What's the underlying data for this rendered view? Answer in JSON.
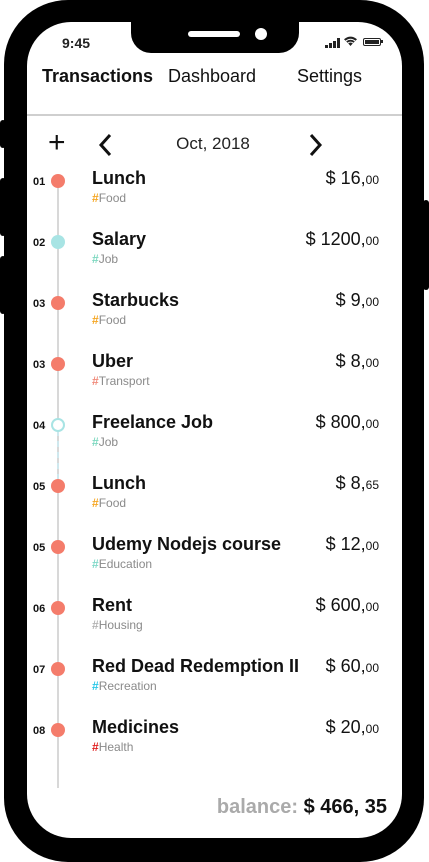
{
  "status_bar": {
    "time": "9:45"
  },
  "tabs": [
    {
      "label": "Transactions"
    },
    {
      "label": "Dashboard"
    },
    {
      "label": "Settings"
    }
  ],
  "period": {
    "label": "Oct, 2018"
  },
  "colors": {
    "food": "#f5a623",
    "job": "#7ed8c0",
    "transport": "#f08a7a",
    "education": "#7fd8c8",
    "housing": "#b3b3b3",
    "recreation": "#29c7e8",
    "health": "#e02020",
    "dot_expense": "#f47c6b",
    "dot_income": "#a8e4e4"
  },
  "transactions": [
    {
      "day": "01",
      "title": "Lunch",
      "tag": "Food",
      "amount_main": "$ 16,",
      "amount_cents": "00"
    },
    {
      "day": "02",
      "title": "Salary",
      "tag": "Job",
      "amount_main": "$ 1200,",
      "amount_cents": "00"
    },
    {
      "day": "03",
      "title": "Starbucks",
      "tag": "Food",
      "amount_main": "$ 9,",
      "amount_cents": "00"
    },
    {
      "day": "03",
      "title": "Uber",
      "tag": "Transport",
      "amount_main": "$ 8,",
      "amount_cents": "00"
    },
    {
      "day": "04",
      "title": "Freelance Job",
      "tag": "Job",
      "amount_main": "$ 800,",
      "amount_cents": "00"
    },
    {
      "day": "05",
      "title": "Lunch",
      "tag": "Food",
      "amount_main": "$ 8,",
      "amount_cents": "65"
    },
    {
      "day": "05",
      "title": "Udemy Nodejs course",
      "tag": "Education",
      "amount_main": "$ 12,",
      "amount_cents": "00"
    },
    {
      "day": "06",
      "title": "Rent",
      "tag": "Housing",
      "amount_main": "$ 600,",
      "amount_cents": "00"
    },
    {
      "day": "07",
      "title": "Red Dead Redemption II",
      "tag": "Recreation",
      "amount_main": "$ 60,",
      "amount_cents": "00"
    },
    {
      "day": "08",
      "title": "Medicines",
      "tag": "Health",
      "amount_main": "$ 20,",
      "amount_cents": "00"
    }
  ],
  "icons": {
    "add": "plus-icon",
    "prev": "chevron-left-icon",
    "next": "chevron-right-icon"
  },
  "balance": {
    "label": "balance:",
    "value": "$ 466, 35"
  }
}
